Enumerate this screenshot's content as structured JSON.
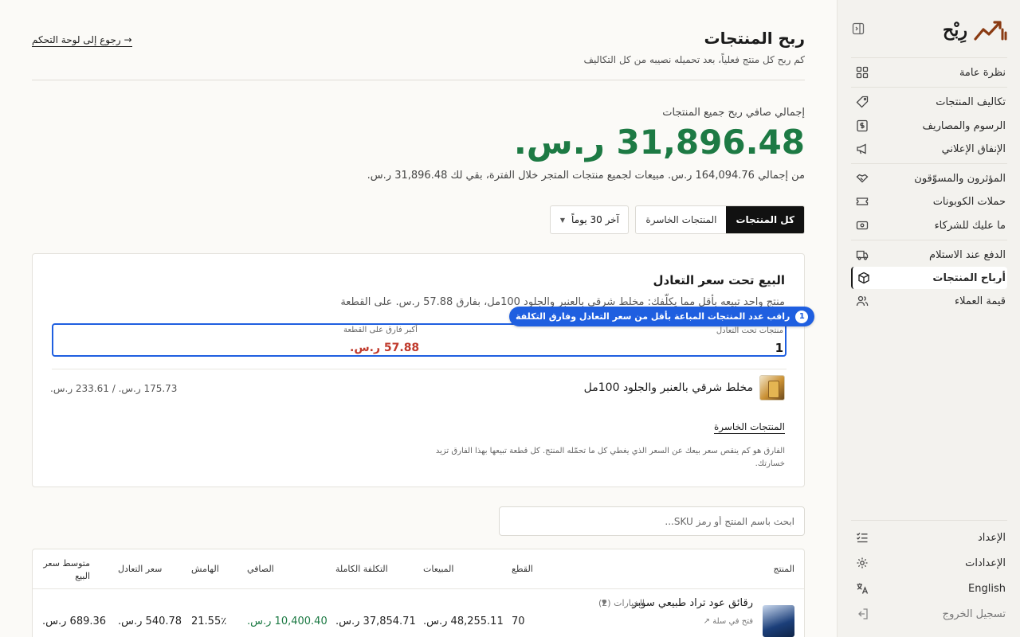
{
  "app": {
    "brand_name": "رِبْح",
    "colors": {
      "accent_green": "#1d7a44",
      "loss_red": "#c0392b",
      "brand_brown": "#8a3b12",
      "highlight_blue": "#1f5fe0"
    }
  },
  "sidebar": {
    "items": [
      {
        "label": "نظرة عامة",
        "icon": "grid-icon"
      },
      {
        "label": "تكاليف المنتجات",
        "icon": "tag-icon"
      },
      {
        "label": "الرسوم والمصاريف",
        "icon": "receipt-icon"
      },
      {
        "label": "الإنفاق الإعلاني",
        "icon": "megaphone-icon"
      },
      {
        "label": "المؤثرون والمسوّقون",
        "icon": "handshake-icon"
      },
      {
        "label": "حملات الكوبونات",
        "icon": "ticket-icon"
      },
      {
        "label": "ما عليك للشركاء",
        "icon": "cash-icon"
      },
      {
        "label": "الدفع عند الاستلام",
        "icon": "truck-icon"
      },
      {
        "label": "أرباح المنتجات",
        "icon": "box-icon"
      },
      {
        "label": "قيمة العملاء",
        "icon": "users-icon"
      }
    ],
    "bottom": [
      {
        "label": "الإعداد",
        "icon": "checklist-icon"
      },
      {
        "label": "الإعدادات",
        "icon": "gear-icon"
      },
      {
        "label": "English",
        "icon": "language-icon"
      },
      {
        "label": "تسجيل الخروج",
        "icon": "logout-icon"
      }
    ]
  },
  "header": {
    "title": "ربح المنتجات",
    "subtitle": "كم ربح كل منتج فعلياً، بعد تحميله نصيبه من كل التكاليف",
    "back_link": "→ رجوع إلى لوحة التحكم"
  },
  "summary": {
    "label": "إجمالي صافي ربح جميع المنتجات",
    "value": "31,896.48 ر.س.",
    "sub": "من إجمالي 164,094.76 ر.س. مبيعات لجميع منتجات المتجر خلال الفترة، بقي لك 31,896.48 ر.س."
  },
  "filters": {
    "period": "آخر 30 يوماً",
    "tabs": [
      "كل المنتجات",
      "المنتجات الخاسرة"
    ],
    "active_tab": "كل المنتجات"
  },
  "below_breakeven": {
    "title": "البيع تحت سعر التعادل",
    "description": "منتج واحد تبيعه بأقل مما يكلّفك: مخلط شرقي بالعنبر والجلود 100مل، بفارق 57.88 ر.س. على القطعة",
    "stat_right_label": "منتجات تحت التعادل",
    "stat_right_value": "1",
    "stat_left_label": "أكبر فارق على القطعة",
    "stat_left_value": "57.88 ر.س.",
    "tooltip_number": "1",
    "tooltip_text": "راقب عدد المنتجات المباعة بأقل من سعر التعادل وفارق التكلفة",
    "product_name": "مخلط شرقي بالعنبر والجلود 100مل",
    "product_price": "175.73 ر.س. / 233.61 ر.س.",
    "losing_link": "المنتجات الخاسرة",
    "note": "الفارق هو كم ينقص سعر بيعك عن السعر الذي يغطي كل ما تحمّله المنتج. كل قطعة تبيعها بهذا الفارق تزيد خسارتك."
  },
  "search": {
    "placeholder": "ابحث باسم المنتج أو رمز SKU..."
  },
  "table": {
    "headers": {
      "product": "المنتج",
      "units": "القطع",
      "sales": "المبيعات",
      "full_cost": "التكلفة الكاملة",
      "net": "الصافي",
      "margin": "الهامش",
      "breakeven": "سعر التعادل",
      "avg_price": "متوسط سعر البيع"
    },
    "rows": [
      {
        "product": "رقائق عود تراد طبيعي سوبر",
        "variants": "الخيارات (2)",
        "open_in_store": "فتح في سلة ↗",
        "units": "70",
        "sales": "48,255.11 ر.س.",
        "full_cost": "37,854.71 ر.س.",
        "net": "10,400.40 ر.س.",
        "margin": "21.55٪",
        "breakeven": "540.78 ر.س.",
        "avg_price": "689.36 ر.س."
      }
    ]
  }
}
